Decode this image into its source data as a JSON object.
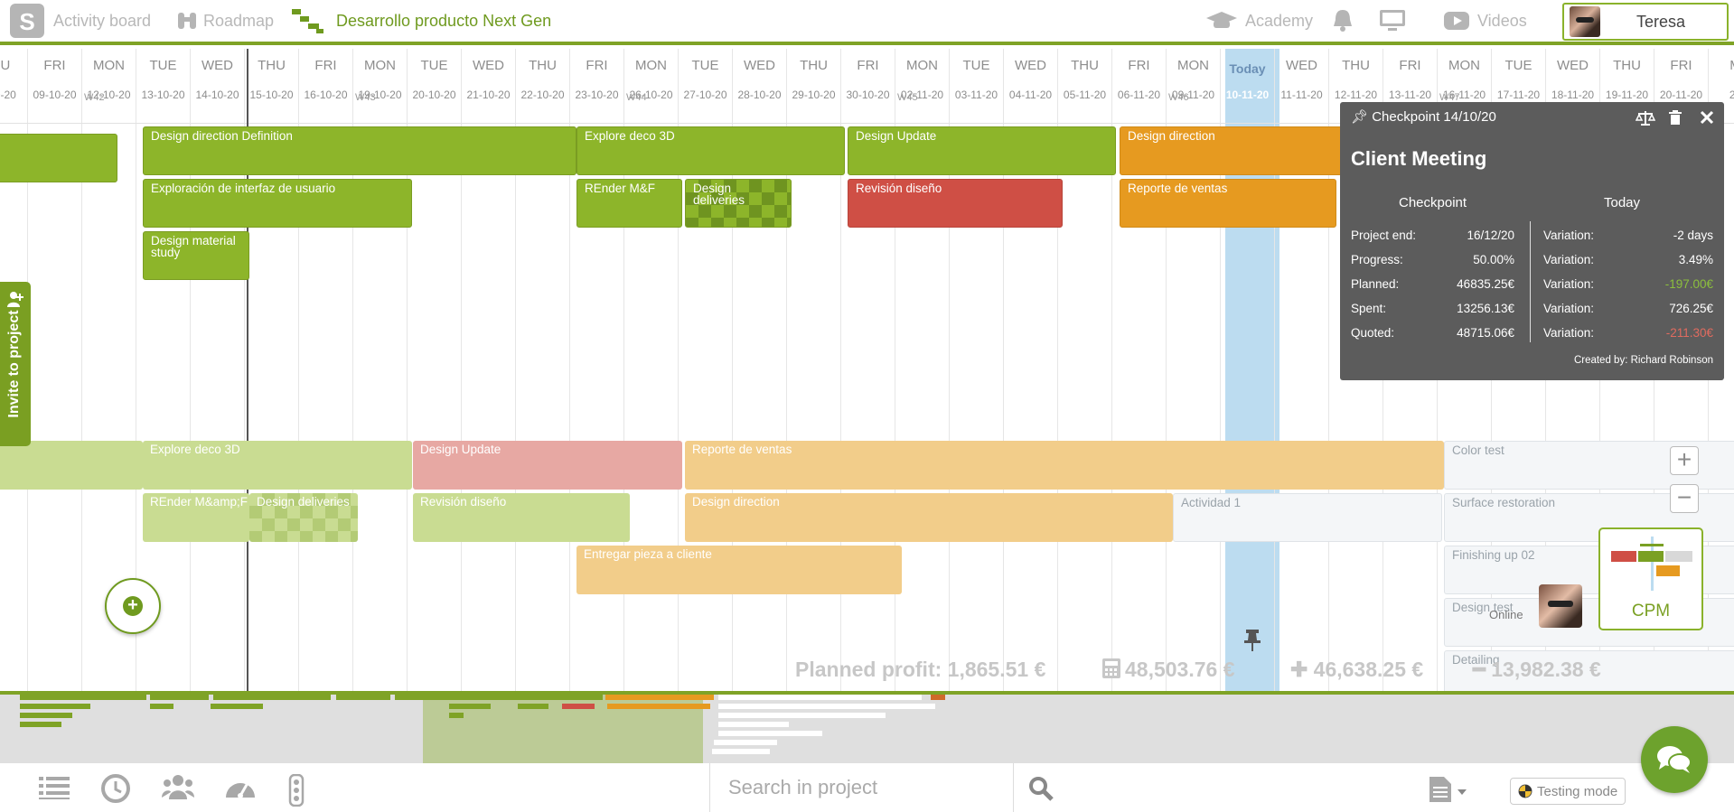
{
  "nav": {
    "activity_board": "Activity board",
    "roadmap": "Roadmap",
    "project_title": "Desarrollo producto Next Gen",
    "academy": "Academy",
    "videos": "Videos",
    "user_name": "Teresa"
  },
  "calendar": {
    "days": [
      {
        "name": "HU",
        "date": "-10-20"
      },
      {
        "name": "FRI",
        "date": "09-10-20"
      },
      {
        "name": "MON",
        "date": "12-10-20",
        "week": "W42"
      },
      {
        "name": "TUE",
        "date": "13-10-20"
      },
      {
        "name": "WED",
        "date": "14-10-20"
      },
      {
        "name": "THU",
        "date": "15-10-20"
      },
      {
        "name": "FRI",
        "date": "16-10-20"
      },
      {
        "name": "MON",
        "date": "19-10-20",
        "week": "W43"
      },
      {
        "name": "TUE",
        "date": "20-10-20"
      },
      {
        "name": "WED",
        "date": "21-10-20"
      },
      {
        "name": "THU",
        "date": "22-10-20"
      },
      {
        "name": "FRI",
        "date": "23-10-20"
      },
      {
        "name": "MON",
        "date": "26-10-20",
        "week": "W44"
      },
      {
        "name": "TUE",
        "date": "27-10-20"
      },
      {
        "name": "WED",
        "date": "28-10-20"
      },
      {
        "name": "THU",
        "date": "29-10-20"
      },
      {
        "name": "FRI",
        "date": "30-10-20"
      },
      {
        "name": "MON",
        "date": "02-11-20",
        "week": "W45"
      },
      {
        "name": "TUE",
        "date": "03-11-20"
      },
      {
        "name": "WED",
        "date": "04-11-20"
      },
      {
        "name": "THU",
        "date": "05-11-20"
      },
      {
        "name": "FRI",
        "date": "06-11-20"
      },
      {
        "name": "MON",
        "date": "09-11-20",
        "week": "W46"
      },
      {
        "name": "Today",
        "date": "10-11-20",
        "today": true
      },
      {
        "name": "WED",
        "date": "11-11-20"
      },
      {
        "name": "THU",
        "date": "12-11-20"
      },
      {
        "name": "FRI",
        "date": "13-11-20"
      },
      {
        "name": "MON",
        "date": "16-11-20",
        "week": "W47"
      },
      {
        "name": "TUE",
        "date": "17-11-20"
      },
      {
        "name": "WED",
        "date": "18-11-20"
      },
      {
        "name": "THU",
        "date": "19-11-20"
      },
      {
        "name": "FRI",
        "date": "20-11-20"
      },
      {
        "name": "M",
        "date": "23"
      }
    ]
  },
  "bars": [
    {
      "label": "",
      "style": "g"
    },
    {
      "label": "Design direction Definition",
      "style": "g"
    },
    {
      "label": "Explore deco 3D",
      "style": "g"
    },
    {
      "label": "Design Update",
      "style": "g"
    },
    {
      "label": "Design direction",
      "style": "o"
    },
    {
      "label": "Exploración de interfaz de usuario",
      "style": "g"
    },
    {
      "label": "REnder M&F",
      "style": "g"
    },
    {
      "label": "Design deliveries",
      "style": "g chk"
    },
    {
      "label": "Revisión diseño",
      "style": "r"
    },
    {
      "label": "Reporte de ventas",
      "style": "o"
    },
    {
      "label": "Design material study",
      "style": "g"
    },
    {
      "label": "",
      "style": "gl"
    },
    {
      "label": "Explore deco 3D",
      "style": "gl"
    },
    {
      "label": "Design Update",
      "style": "rl"
    },
    {
      "label": "Reporte de ventas",
      "style": "ol"
    },
    {
      "label": "Color test",
      "style": "wl"
    },
    {
      "label": "REnder M&amp;F",
      "style": "gl"
    },
    {
      "label": "Design deliveries",
      "style": "gl chkl"
    },
    {
      "label": "Revisión diseño",
      "style": "gl"
    },
    {
      "label": "Design direction",
      "style": "ol"
    },
    {
      "label": "Actividad 1",
      "style": "wl"
    },
    {
      "label": "Surface restoration",
      "style": "wl"
    },
    {
      "label": "Entregar pieza a cliente",
      "style": "ol"
    },
    {
      "label": "Finishing up 02",
      "style": "wl"
    },
    {
      "label": "Design test",
      "style": "wl"
    },
    {
      "label": "Detailing",
      "style": "wl"
    }
  ],
  "sidebar": {
    "invite_label": "Invite to project"
  },
  "popup": {
    "header": "Checkpoint 14/10/20",
    "title": "Client Meeting",
    "col_checkpoint": "Checkpoint",
    "col_today": "Today",
    "rows": [
      {
        "label": "Project end:",
        "value": "16/12/20",
        "var_label": "Variation:",
        "variation": "-2 days",
        "tone": ""
      },
      {
        "label": "Progress:",
        "value": "50.00%",
        "var_label": "Variation:",
        "variation": "3.49%",
        "tone": ""
      },
      {
        "label": "Planned:",
        "value": "46835.25€",
        "var_label": "Variation:",
        "variation": "-197.00€",
        "tone": "green"
      },
      {
        "label": "Spent:",
        "value": "13256.13€",
        "var_label": "Variation:",
        "variation": "726.25€",
        "tone": ""
      },
      {
        "label": "Quoted:",
        "value": "48715.06€",
        "var_label": "Variation:",
        "variation": "-211.30€",
        "tone": "red"
      }
    ],
    "created_by": "Created by: Richard Robinson"
  },
  "zoom": {
    "plus": "+",
    "minus": "−"
  },
  "cpm": {
    "label": "CPM"
  },
  "online": {
    "label": "Online"
  },
  "profit": {
    "planned": "Planned profit: 1,865.51 €",
    "total": "48,503.76 €",
    "plus": "46,638.25 €",
    "minus": "13,982.38 €"
  },
  "search": {
    "placeholder": "Search in project"
  },
  "testing": {
    "label": "Testing mode"
  },
  "colors": {
    "accent": "#7fa326",
    "green": "#8db52a",
    "red": "#cf4f45",
    "orange": "#e69a20",
    "today": "#bcdcf0"
  }
}
